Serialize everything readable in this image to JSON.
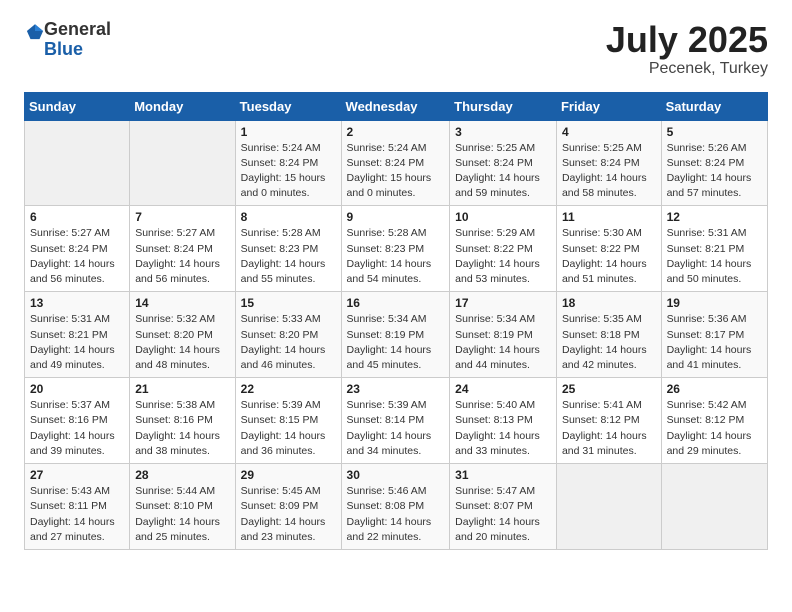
{
  "logo": {
    "general": "General",
    "blue": "Blue"
  },
  "header": {
    "month": "July 2025",
    "location": "Pecenek, Turkey"
  },
  "weekdays": [
    "Sunday",
    "Monday",
    "Tuesday",
    "Wednesday",
    "Thursday",
    "Friday",
    "Saturday"
  ],
  "weeks": [
    [
      {
        "day": "",
        "info": ""
      },
      {
        "day": "",
        "info": ""
      },
      {
        "day": "1",
        "info": "Sunrise: 5:24 AM\nSunset: 8:24 PM\nDaylight: 15 hours\nand 0 minutes."
      },
      {
        "day": "2",
        "info": "Sunrise: 5:24 AM\nSunset: 8:24 PM\nDaylight: 15 hours\nand 0 minutes."
      },
      {
        "day": "3",
        "info": "Sunrise: 5:25 AM\nSunset: 8:24 PM\nDaylight: 14 hours\nand 59 minutes."
      },
      {
        "day": "4",
        "info": "Sunrise: 5:25 AM\nSunset: 8:24 PM\nDaylight: 14 hours\nand 58 minutes."
      },
      {
        "day": "5",
        "info": "Sunrise: 5:26 AM\nSunset: 8:24 PM\nDaylight: 14 hours\nand 57 minutes."
      }
    ],
    [
      {
        "day": "6",
        "info": "Sunrise: 5:27 AM\nSunset: 8:24 PM\nDaylight: 14 hours\nand 56 minutes."
      },
      {
        "day": "7",
        "info": "Sunrise: 5:27 AM\nSunset: 8:24 PM\nDaylight: 14 hours\nand 56 minutes."
      },
      {
        "day": "8",
        "info": "Sunrise: 5:28 AM\nSunset: 8:23 PM\nDaylight: 14 hours\nand 55 minutes."
      },
      {
        "day": "9",
        "info": "Sunrise: 5:28 AM\nSunset: 8:23 PM\nDaylight: 14 hours\nand 54 minutes."
      },
      {
        "day": "10",
        "info": "Sunrise: 5:29 AM\nSunset: 8:22 PM\nDaylight: 14 hours\nand 53 minutes."
      },
      {
        "day": "11",
        "info": "Sunrise: 5:30 AM\nSunset: 8:22 PM\nDaylight: 14 hours\nand 51 minutes."
      },
      {
        "day": "12",
        "info": "Sunrise: 5:31 AM\nSunset: 8:21 PM\nDaylight: 14 hours\nand 50 minutes."
      }
    ],
    [
      {
        "day": "13",
        "info": "Sunrise: 5:31 AM\nSunset: 8:21 PM\nDaylight: 14 hours\nand 49 minutes."
      },
      {
        "day": "14",
        "info": "Sunrise: 5:32 AM\nSunset: 8:20 PM\nDaylight: 14 hours\nand 48 minutes."
      },
      {
        "day": "15",
        "info": "Sunrise: 5:33 AM\nSunset: 8:20 PM\nDaylight: 14 hours\nand 46 minutes."
      },
      {
        "day": "16",
        "info": "Sunrise: 5:34 AM\nSunset: 8:19 PM\nDaylight: 14 hours\nand 45 minutes."
      },
      {
        "day": "17",
        "info": "Sunrise: 5:34 AM\nSunset: 8:19 PM\nDaylight: 14 hours\nand 44 minutes."
      },
      {
        "day": "18",
        "info": "Sunrise: 5:35 AM\nSunset: 8:18 PM\nDaylight: 14 hours\nand 42 minutes."
      },
      {
        "day": "19",
        "info": "Sunrise: 5:36 AM\nSunset: 8:17 PM\nDaylight: 14 hours\nand 41 minutes."
      }
    ],
    [
      {
        "day": "20",
        "info": "Sunrise: 5:37 AM\nSunset: 8:16 PM\nDaylight: 14 hours\nand 39 minutes."
      },
      {
        "day": "21",
        "info": "Sunrise: 5:38 AM\nSunset: 8:16 PM\nDaylight: 14 hours\nand 38 minutes."
      },
      {
        "day": "22",
        "info": "Sunrise: 5:39 AM\nSunset: 8:15 PM\nDaylight: 14 hours\nand 36 minutes."
      },
      {
        "day": "23",
        "info": "Sunrise: 5:39 AM\nSunset: 8:14 PM\nDaylight: 14 hours\nand 34 minutes."
      },
      {
        "day": "24",
        "info": "Sunrise: 5:40 AM\nSunset: 8:13 PM\nDaylight: 14 hours\nand 33 minutes."
      },
      {
        "day": "25",
        "info": "Sunrise: 5:41 AM\nSunset: 8:12 PM\nDaylight: 14 hours\nand 31 minutes."
      },
      {
        "day": "26",
        "info": "Sunrise: 5:42 AM\nSunset: 8:12 PM\nDaylight: 14 hours\nand 29 minutes."
      }
    ],
    [
      {
        "day": "27",
        "info": "Sunrise: 5:43 AM\nSunset: 8:11 PM\nDaylight: 14 hours\nand 27 minutes."
      },
      {
        "day": "28",
        "info": "Sunrise: 5:44 AM\nSunset: 8:10 PM\nDaylight: 14 hours\nand 25 minutes."
      },
      {
        "day": "29",
        "info": "Sunrise: 5:45 AM\nSunset: 8:09 PM\nDaylight: 14 hours\nand 23 minutes."
      },
      {
        "day": "30",
        "info": "Sunrise: 5:46 AM\nSunset: 8:08 PM\nDaylight: 14 hours\nand 22 minutes."
      },
      {
        "day": "31",
        "info": "Sunrise: 5:47 AM\nSunset: 8:07 PM\nDaylight: 14 hours\nand 20 minutes."
      },
      {
        "day": "",
        "info": ""
      },
      {
        "day": "",
        "info": ""
      }
    ]
  ]
}
